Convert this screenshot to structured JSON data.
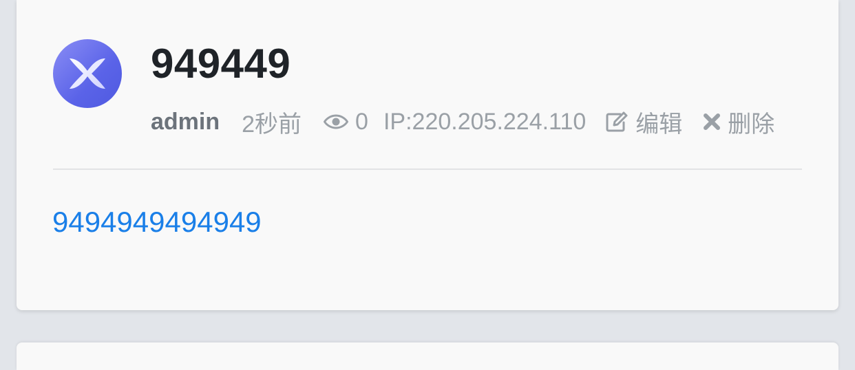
{
  "post": {
    "title": "949449",
    "author": "admin",
    "time": "2秒前",
    "views": "0",
    "ip": "IP:220.205.224.110",
    "edit_label": "编辑",
    "delete_label": "删除",
    "content": "9494949494949"
  },
  "icons": {
    "avatar": "x-logo-avatar",
    "views": "eye-icon",
    "edit": "edit-icon",
    "delete": "close-icon"
  },
  "colors": {
    "background": "#e2e5ea",
    "card": "#f9f9f9",
    "title": "#1f2328",
    "meta": "#9aa0a6",
    "author": "#6c737b",
    "link": "#1a7fe8",
    "avatar_accent": "#5a63e8"
  }
}
